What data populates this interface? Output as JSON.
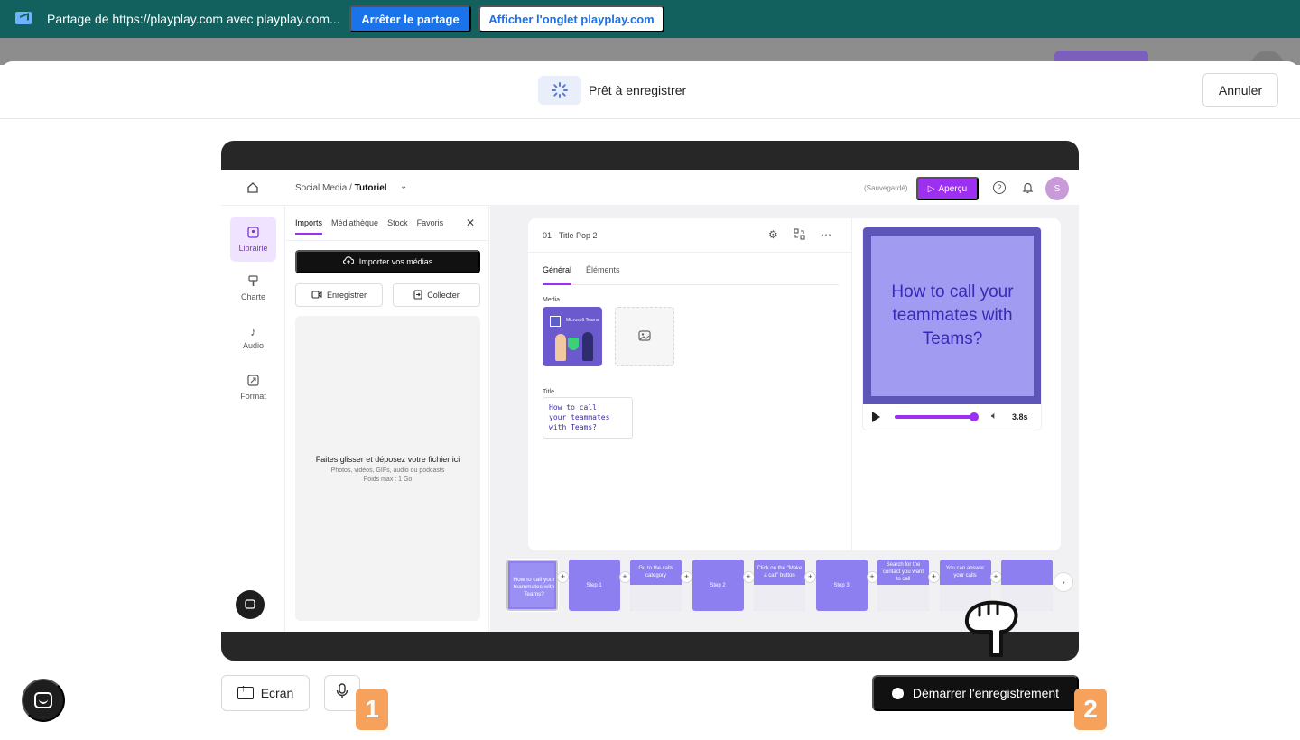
{
  "sharebar": {
    "text": "Partage de https://playplay.com avec playplay.com...",
    "stop_label": "Arrêter le partage",
    "show_label": "Afficher l'onglet playplay.com"
  },
  "modal": {
    "status_text": "Prêt à enregistrer",
    "cancel_label": "Annuler"
  },
  "app": {
    "breadcrumb_parent": "Social Media",
    "breadcrumb_separator": " / ",
    "breadcrumb_current": "Tutoriel",
    "saved_text": "(Sauvegardé)",
    "preview_label": "Aperçu",
    "avatar_initial": "S",
    "nav": [
      {
        "label": "Librairie",
        "icon": "library-icon"
      },
      {
        "label": "Charte",
        "icon": "brush-icon"
      },
      {
        "label": "Audio",
        "icon": "music-note-icon"
      },
      {
        "label": "Format",
        "icon": "resize-icon"
      }
    ],
    "library": {
      "tabs": [
        "Imports",
        "Médiathèque",
        "Stock",
        "Favoris"
      ],
      "import_label": "Importer vos médias",
      "record_label": "Enregistrer",
      "collect_label": "Collecter",
      "drop_title": "Faites glisser et déposez votre fichier ici",
      "drop_sub": "Photos, vidéos, GIFs, audio ou podcasts",
      "drop_size": "Poids max : 1 Go"
    },
    "editor": {
      "title": "01 - Title Pop 2",
      "tabs": [
        "Général",
        "Éléments"
      ],
      "media_label": "Media",
      "media_thumb_text": "Microsoft Teams",
      "title_label": "Title",
      "title_value": "How to call\nyour teammates\nwith Teams?"
    },
    "video": {
      "text": "How to call your teammates with Teams?",
      "progress": 1.0,
      "duration": "3.8s"
    },
    "timeline": {
      "slides": [
        {
          "label": "How to call your teammates with Teams?",
          "style": "first"
        },
        {
          "label": "Step 1",
          "style": "purple"
        },
        {
          "label": "Go to the calls category",
          "style": "mixed"
        },
        {
          "label": "Step 2",
          "style": "purple"
        },
        {
          "label": "Click on the \"Make a call\" button",
          "style": "mixed"
        },
        {
          "label": "Step 3",
          "style": "purple"
        },
        {
          "label": "Search for the contact you want to call",
          "style": "mixed"
        },
        {
          "label": "You can answer your calls",
          "style": "mixed"
        },
        {
          "label": "",
          "style": "mixed"
        }
      ]
    }
  },
  "controls": {
    "screen_label": "Ecran",
    "badge_1": "1",
    "badge_2": "2",
    "start_label": "Démarrer l'enregistrement"
  }
}
